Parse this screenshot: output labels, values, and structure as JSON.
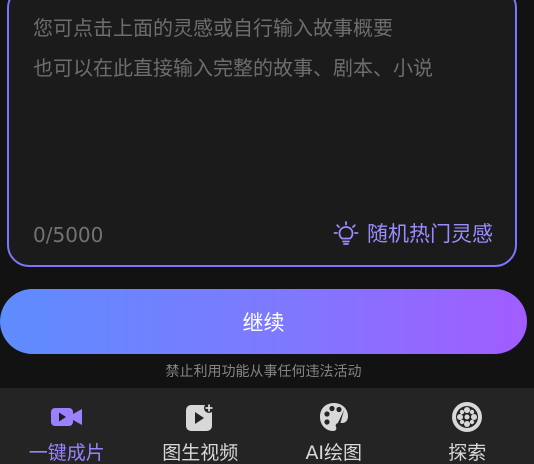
{
  "story_input": {
    "placeholder_lines": "您可点击上面的灵感或自行输入故事概要\n也可以在此直接输入完整的故事、剧本、小说",
    "char_count": "0/5000",
    "inspiration_label": "随机热门灵感"
  },
  "continue_button": {
    "label": "继续"
  },
  "notice": "禁止利用功能从事任何违法活动",
  "bottom_nav": {
    "items": [
      {
        "label": "一键成片",
        "icon": "video-camera-icon",
        "active": true
      },
      {
        "label": "图生视频",
        "icon": "image-to-video-icon",
        "active": false
      },
      {
        "label": "AI绘图",
        "icon": "palette-icon",
        "active": false
      },
      {
        "label": "探索",
        "icon": "reel-icon",
        "active": false
      }
    ]
  },
  "colors": {
    "accent": "#9a82ff",
    "border": "#7d74ff",
    "button_gradient_start": "#5e8cff",
    "button_gradient_end": "#a15cff"
  }
}
